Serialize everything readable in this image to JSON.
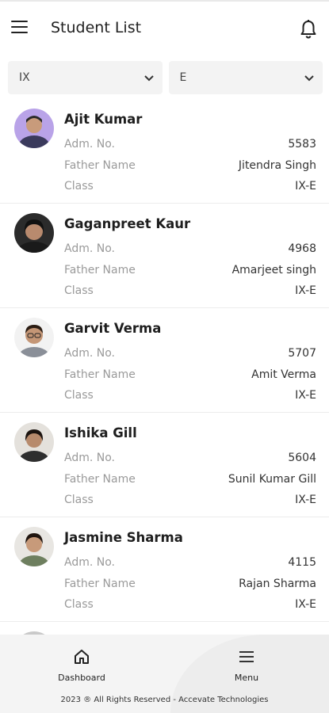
{
  "header": {
    "title": "Student List",
    "menu_icon": "hamburger-icon",
    "bell_icon": "bell-icon"
  },
  "filters": {
    "class_value": "IX",
    "section_value": "E"
  },
  "labels": {
    "adm": "Adm. No.",
    "father": "Father Name",
    "class": "Class"
  },
  "students": [
    {
      "name": "Ajit Kumar",
      "adm_no": "5583",
      "father_name": "Jitendra Singh",
      "class": "IX-E"
    },
    {
      "name": "Gaganpreet Kaur",
      "adm_no": "4968",
      "father_name": "Amarjeet singh",
      "class": "IX-E"
    },
    {
      "name": "Garvit  Verma",
      "adm_no": "5707",
      "father_name": "Amit Verma",
      "class": "IX-E"
    },
    {
      "name": "Ishika Gill",
      "adm_no": "5604",
      "father_name": "Sunil Kumar Gill",
      "class": "IX-E"
    },
    {
      "name": "Jasmine Sharma",
      "adm_no": "4115",
      "father_name": "Rajan Sharma",
      "class": "IX-E"
    }
  ],
  "bottom_nav": {
    "dashboard": "Dashboard",
    "menu": "Menu"
  },
  "footer": "2023 ® All Rights Reserved - Accevate Technologies",
  "colors": {
    "background": "#ffffff",
    "filter_bg": "#f3f3f3",
    "label": "#9a9a9a",
    "bottom_bg": "#f4f4f4"
  }
}
